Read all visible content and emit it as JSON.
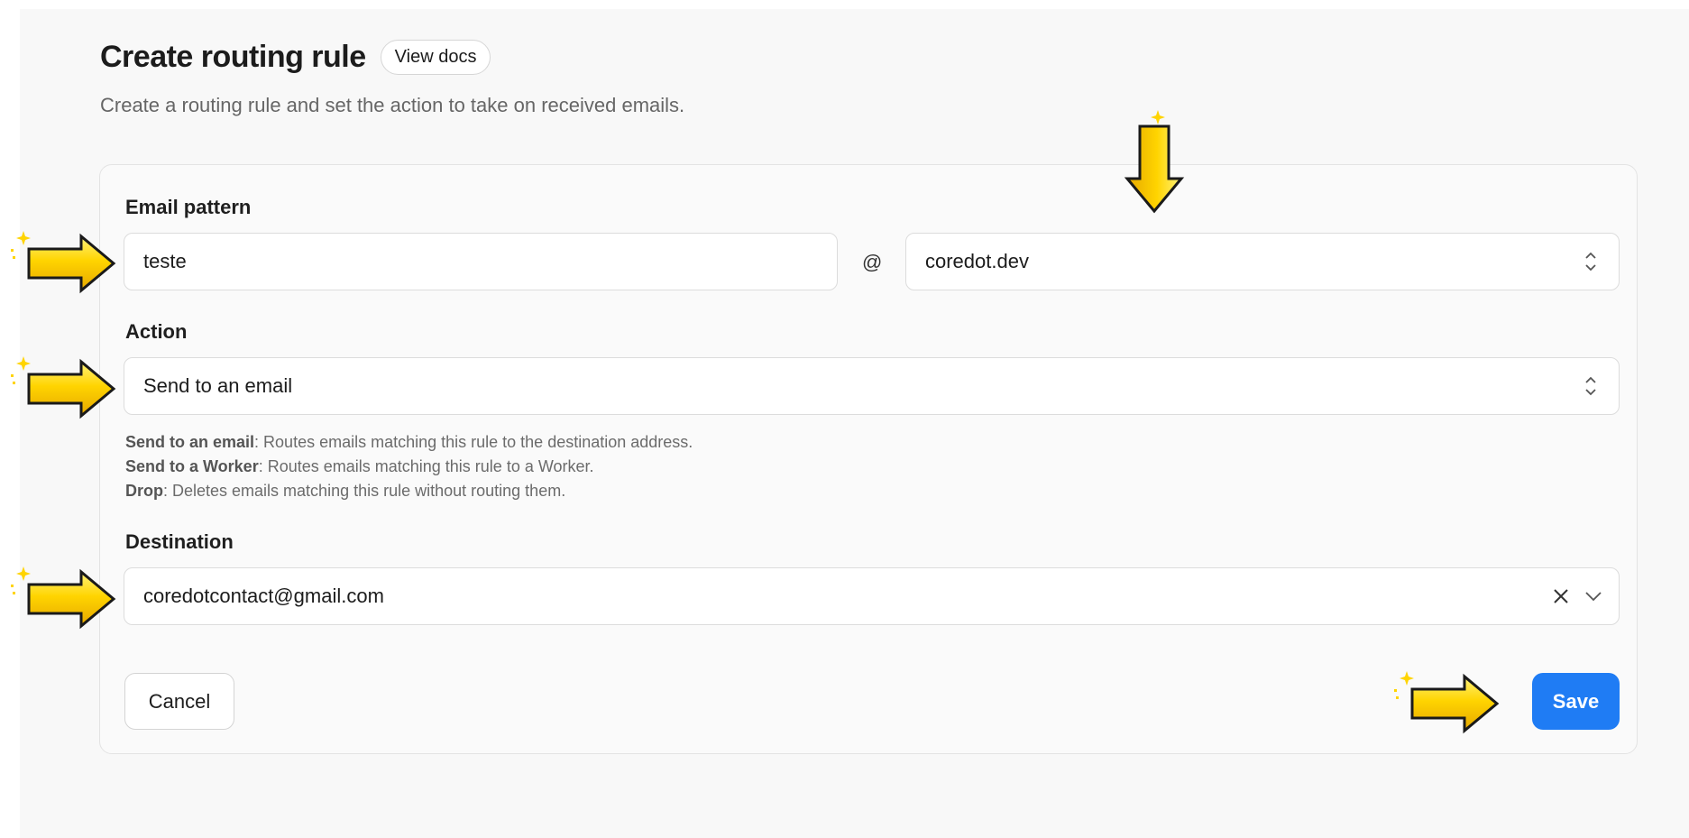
{
  "header": {
    "title": "Create routing rule",
    "docs_button": "View docs",
    "subtitle": "Create a routing rule and set the action to take on received emails."
  },
  "email_pattern": {
    "label": "Email pattern",
    "local_part": "teste",
    "at": "@",
    "domain": "coredot.dev"
  },
  "action": {
    "label": "Action",
    "selected": "Send to an email",
    "help": [
      {
        "term": "Send to an email",
        "desc": ": Routes emails matching this rule to the destination address."
      },
      {
        "term": "Send to a Worker",
        "desc": ": Routes emails matching this rule to a Worker."
      },
      {
        "term": "Drop",
        "desc": ": Deletes emails matching this rule without routing them."
      }
    ]
  },
  "destination": {
    "label": "Destination",
    "value": "coredotcontact@gmail.com"
  },
  "footer": {
    "cancel_label": "Cancel",
    "save_label": "Save"
  },
  "colors": {
    "save_button": "#1f7cf4",
    "annotation_arrow": "#ffd400"
  },
  "annotations": [
    "pointer-arrow-icon",
    "pointer-arrow-icon",
    "pointer-arrow-icon",
    "pointer-arrow-icon",
    "pointer-arrow-icon"
  ]
}
